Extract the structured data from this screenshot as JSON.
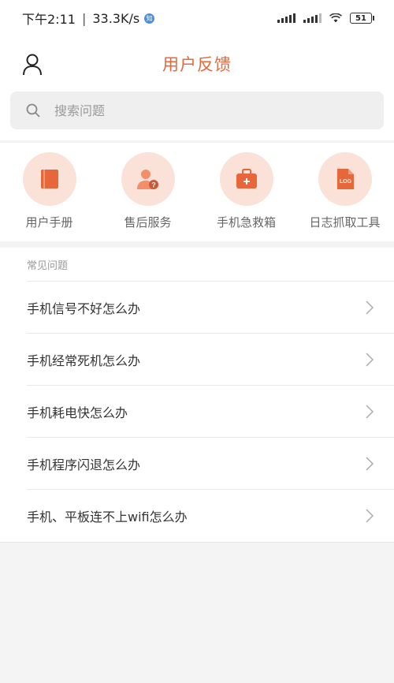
{
  "status": {
    "time_speed": "下午2:11",
    "speed": "33.3K/s",
    "battery": "51"
  },
  "header": {
    "title": "用户反馈"
  },
  "search": {
    "placeholder": "搜索问题"
  },
  "tools": [
    {
      "label": "用户手册",
      "icon": "book-icon"
    },
    {
      "label": "售后服务",
      "icon": "support-person-icon"
    },
    {
      "label": "手机急救箱",
      "icon": "first-aid-kit-icon"
    },
    {
      "label": "日志抓取工具",
      "icon": "log-file-icon"
    }
  ],
  "faq": {
    "title": "常见问题",
    "items": [
      {
        "label": "手机信号不好怎么办"
      },
      {
        "label": "手机经常死机怎么办"
      },
      {
        "label": "手机耗电快怎么办"
      },
      {
        "label": "手机程序闪退怎么办"
      },
      {
        "label": "手机、平板连不上wifi怎么办"
      }
    ]
  },
  "colors": {
    "accent": "#e8673a",
    "icon_bg": "#fbe2d9"
  }
}
